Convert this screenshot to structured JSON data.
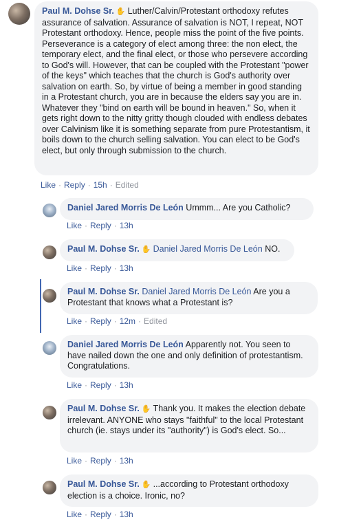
{
  "top": {
    "author": "Paul M. Dohse Sr.",
    "text": "Luther/Calvin/Protestant orthodoxy refutes assurance of salvation. Assurance of salvation is NOT, I repeat, NOT Protestant orthodoxy. Hence, people miss the point of the five points. Perseverance is a category of elect among three: the non elect, the temporary elect, and the final elect, or those who persevere according to God's will. However, that can be coupled with the Protestant \"power of the keys\" which teaches that the church is God's authority over salvation on earth. So, by virtue of being a member in good standing in a Protestant church, you are in because the elders say you are in. Whatever they \"bind on earth will be bound in heaven.\" So, when it gets right down to the nitty gritty though clouded with endless debates over Calvinism like it is something separate from pure Protestantism, it boils down to the church selling salvation. You can elect to be God's elect, but only through submission to the church.",
    "like": "Like",
    "reply": "Reply",
    "time": "15h",
    "edited": "Edited"
  },
  "replies": [
    {
      "author": "Daniel Jared Morris De León",
      "text": "Ummm... Are you Catholic?",
      "like": "Like",
      "reply": "Reply",
      "time": "13h"
    },
    {
      "author": "Paul M. Dohse Sr.",
      "tag": "Daniel Jared Morris De León",
      "text": "NO.",
      "like": "Like",
      "reply": "Reply",
      "time": "13h"
    },
    {
      "author": "Paul M. Dohse Sr.",
      "tag": "Daniel Jared Morris De León",
      "text": "Are you a Protestant that knows what a Protestant is?",
      "like": "Like",
      "reply": "Reply",
      "time": "12m",
      "edited": "Edited"
    },
    {
      "author": "Daniel Jared Morris De León",
      "text": "Apparently not. You seen to have nailed down the one and only definition of protestantism. Congratulations.",
      "like": "Like",
      "reply": "Reply",
      "time": "13h"
    },
    {
      "author": "Paul M. Dohse Sr.",
      "text": "Thank you. It makes the election debate irrelevant. ANYONE who stays \"faithful\" to the local Protestant church (ie. stays under its \"authority\") is God's elect. So...",
      "like": "Like",
      "reply": "Reply",
      "time": "13h"
    },
    {
      "author": "Paul M. Dohse Sr.",
      "text": "...according to Protestant orthodoxy election is a choice. Ironic, no?",
      "like": "Like",
      "reply": "Reply",
      "time": "13h"
    }
  ],
  "icons": {
    "wave": "raised-hand-icon"
  }
}
